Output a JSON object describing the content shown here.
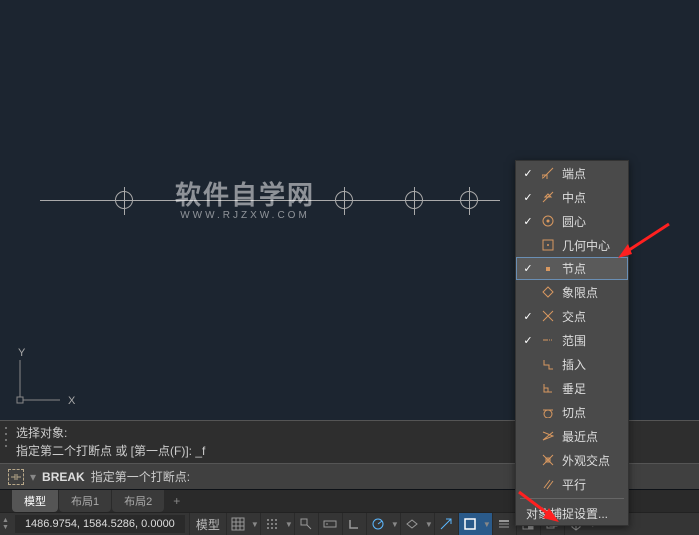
{
  "watermark": {
    "title": "软件自学网",
    "url": "WWW.RJZXW.COM"
  },
  "ucs": {
    "x": "X",
    "y": "Y"
  },
  "command": {
    "history_line1": "选择对象:",
    "history_line2": "指定第二个打断点 或 [第一点(F)]: _f",
    "active_cmd": "BREAK",
    "prompt": "指定第一个打断点:"
  },
  "tabs": {
    "items": [
      "模型",
      "布局1",
      "布局2"
    ],
    "active_index": 0,
    "add_label": "+"
  },
  "statusbar": {
    "coords": "1486.9754, 1584.5286, 0.0000",
    "model_label": "模型"
  },
  "osnap_menu": {
    "items": [
      {
        "label": "端点",
        "checked": true,
        "icon": "endpoint"
      },
      {
        "label": "中点",
        "checked": true,
        "icon": "midpoint"
      },
      {
        "label": "圆心",
        "checked": true,
        "icon": "center"
      },
      {
        "label": "几何中心",
        "checked": false,
        "icon": "geocenter"
      },
      {
        "label": "节点",
        "checked": true,
        "icon": "node",
        "highlight": true
      },
      {
        "label": "象限点",
        "checked": false,
        "icon": "quadrant"
      },
      {
        "label": "交点",
        "checked": true,
        "icon": "intersection"
      },
      {
        "label": "范围",
        "checked": true,
        "icon": "extension"
      },
      {
        "label": "插入",
        "checked": false,
        "icon": "insert"
      },
      {
        "label": "垂足",
        "checked": false,
        "icon": "perpendicular"
      },
      {
        "label": "切点",
        "checked": false,
        "icon": "tangent"
      },
      {
        "label": "最近点",
        "checked": false,
        "icon": "nearest"
      },
      {
        "label": "外观交点",
        "checked": false,
        "icon": "apparent"
      },
      {
        "label": "平行",
        "checked": false,
        "icon": "parallel"
      }
    ],
    "settings_label": "对象捕捉设置..."
  }
}
